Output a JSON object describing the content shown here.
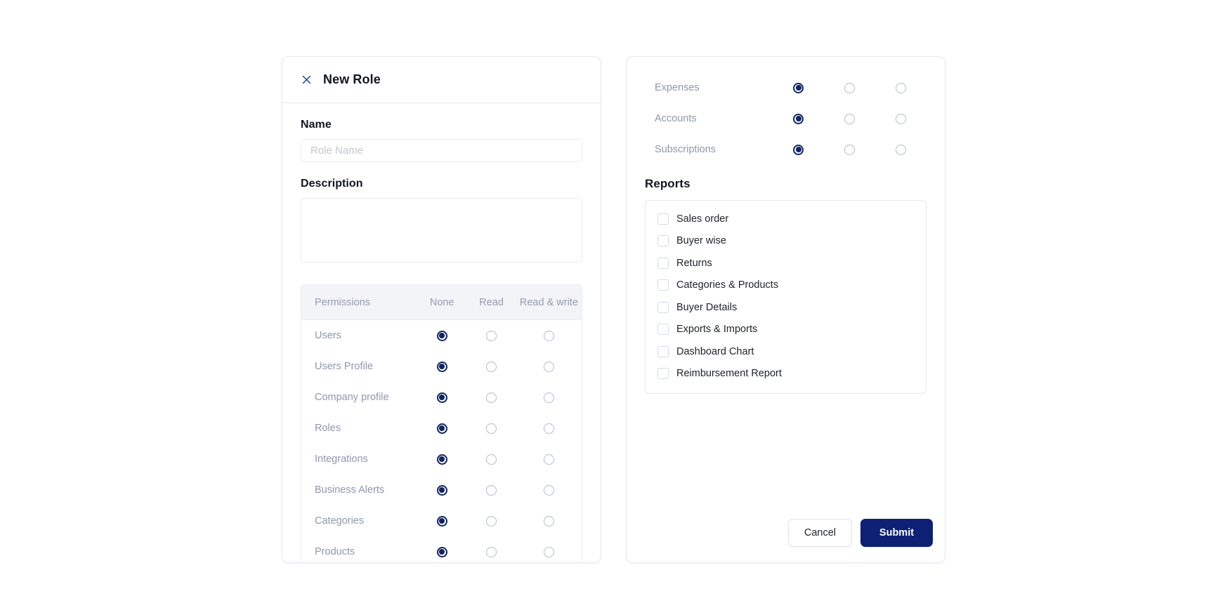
{
  "colors": {
    "accent_navy": "#11245f",
    "submit_bg": "#0d2073",
    "panel_border": "#e3e7ee",
    "muted_text": "#8e98ab",
    "header_row_bg": "#f2f4f8"
  },
  "left_panel": {
    "title": "New Role",
    "close_icon": "close-icon",
    "name": {
      "label": "Name",
      "placeholder": "Role Name",
      "value": ""
    },
    "description": {
      "label": "Description",
      "placeholder": "",
      "value": ""
    },
    "permissions_table": {
      "columns": [
        "Permissions",
        "None",
        "Read",
        "Read & write"
      ],
      "rows": [
        {
          "label": "Users",
          "selected": "None"
        },
        {
          "label": "Users Profile",
          "selected": "None"
        },
        {
          "label": "Company profile",
          "selected": "None"
        },
        {
          "label": "Roles",
          "selected": "None"
        },
        {
          "label": "Integrations",
          "selected": "None"
        },
        {
          "label": "Business Alerts",
          "selected": "None"
        },
        {
          "label": "Categories",
          "selected": "None"
        },
        {
          "label": "Products",
          "selected": "None"
        }
      ]
    }
  },
  "right_panel": {
    "permissions_rows": [
      {
        "label": "Expenses",
        "selected": "None"
      },
      {
        "label": "Accounts",
        "selected": "None"
      },
      {
        "label": "Subscriptions",
        "selected": "None"
      }
    ],
    "reports": {
      "title": "Reports",
      "items": [
        {
          "label": "Sales order",
          "checked": false
        },
        {
          "label": "Buyer wise",
          "checked": false
        },
        {
          "label": "Returns",
          "checked": false
        },
        {
          "label": "Categories & Products",
          "checked": false
        },
        {
          "label": "Buyer Details",
          "checked": false
        },
        {
          "label": "Exports & Imports",
          "checked": false
        },
        {
          "label": "Dashboard Chart",
          "checked": false
        },
        {
          "label": "Reimbursement Report",
          "checked": false
        }
      ]
    },
    "footer": {
      "cancel_label": "Cancel",
      "submit_label": "Submit"
    }
  }
}
